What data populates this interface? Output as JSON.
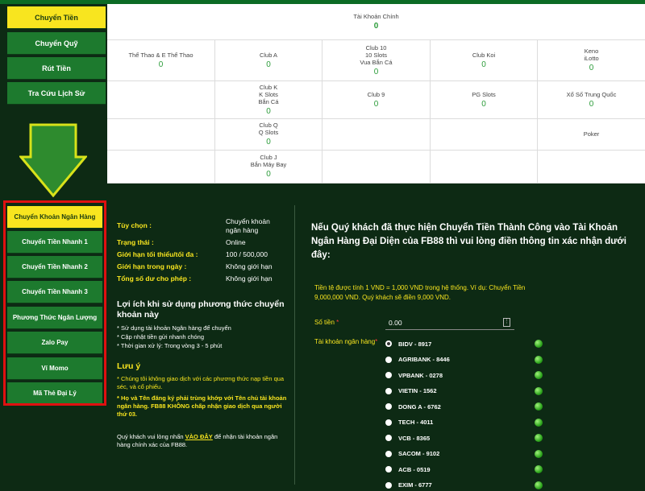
{
  "left_nav": [
    "Chuyển Tiền",
    "Chuyển Quỹ",
    "Rút Tiền",
    "Tra Cứu Lịch Sử"
  ],
  "wallets": {
    "main": {
      "name": "Tài Khoản Chính",
      "value": "0"
    },
    "cells": [
      {
        "name": "Thể Thao & E Thể Thao",
        "value": "0"
      },
      {
        "name": "Club A",
        "value": "0"
      },
      {
        "name": "Club 10\n10 Slots\nVua Bắn Cá",
        "value": "0"
      },
      {
        "name": "Club Koi",
        "value": "0"
      },
      {
        "name": "Keno\niLotto",
        "value": "0"
      },
      {
        "name": "",
        "value": ""
      },
      {
        "name": "Club K\nK Slots\nBắn Cá",
        "value": "0"
      },
      {
        "name": "Club 9",
        "value": "0"
      },
      {
        "name": "PG Slots",
        "value": "0"
      },
      {
        "name": "Xổ Số Trung Quốc",
        "value": "0"
      },
      {
        "name": "",
        "value": ""
      },
      {
        "name": "Club Q\nQ Slots",
        "value": "0"
      },
      {
        "name": "",
        "value": ""
      },
      {
        "name": "",
        "value": ""
      },
      {
        "name": "Poker",
        "value": ""
      },
      {
        "name": "",
        "value": ""
      },
      {
        "name": "Club J\nBắn Máy Bay",
        "value": "0"
      },
      {
        "name": "",
        "value": ""
      },
      {
        "name": "",
        "value": ""
      },
      {
        "name": "",
        "value": ""
      }
    ]
  },
  "method_tabs": [
    "Chuyển Khoản Ngân Hàng",
    "Chuyển Tiền Nhanh 1",
    "Chuyển Tiền Nhanh 2",
    "Chuyển Tiền Nhanh 3",
    "Phương Thức Ngân Lượng",
    "Zalo Pay",
    "Ví Momo",
    "Mã Thẻ Đại Lý"
  ],
  "info": {
    "option_label": "Tùy chọn :",
    "option_value": "Chuyển khoản\nngân hàng",
    "status_label": "Trạng thái :",
    "status_value": "Online",
    "limit_label": "Giới hạn tối thiểu/tối đa :",
    "limit_value": "100 / 500,000",
    "daily_label": "Giới hạn trong ngày :",
    "daily_value": "Không giới hạn",
    "balance_label": "Tổng số dư cho phép :",
    "balance_value": "Không giới hạn"
  },
  "benefits": {
    "title": "Lợi ích khi sử dụng phương thức chuyển khoản này",
    "items": [
      "* Sử dụng tài khoản Ngân hàng để chuyển",
      "* Cập nhật tiền gửi nhanh chóng",
      "* Thời gian xử lý: Trong vòng 3 - 5 phút"
    ]
  },
  "notes": {
    "title": "Lưu ý",
    "item1": "* Chúng tôi không giao dịch với các phương thức nạp tiền qua séc, và cổ phiếu.",
    "item2": "* Họ và Tên đăng ký phải trùng khớp với Tên chủ tài khoản ngân hàng. FB88 KHÔNG chấp nhận giao dịch qua người thứ 03."
  },
  "footer": {
    "pre": "Quý khách vui lòng nhấn ",
    "link": "VÀO ĐÂY",
    "post": " để nhận tài khoản ngân hàng chính xác của FB88."
  },
  "form": {
    "heading": "Nếu Quý khách đã thực hiện Chuyển Tiền Thành Công vào Tài Khoản Ngân Hàng Đại Diện của FB88 thì vui lòng điền thông tin xác nhận dưới đây:",
    "note": "Tiền tệ được tính 1 VND = 1,000 VND trong hệ thống. Ví dụ: Chuyển Tiền 9,000,000 VND. Quý khách sẽ điền 9,000 VND.",
    "amount_label": "Số tiền",
    "amount_value": "0.00",
    "bank_label": "Tài khoản ngân hàng",
    "required_mark": "*",
    "banks": [
      "BIDV - 8917",
      "AGRIBANK - 8446",
      "VPBANK - 0278",
      "VIETIN - 1562",
      "DONG A - 6762",
      "TECH - 4011",
      "VCB - 8365",
      "SACOM - 9102",
      "ACB - 0519",
      "EXIM - 6777"
    ]
  }
}
